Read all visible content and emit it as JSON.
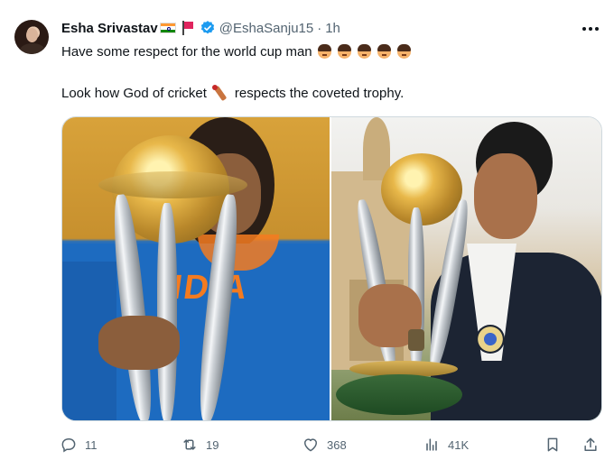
{
  "author": {
    "display_name": "Esha Srivastav",
    "handle": "@EshaSanju15",
    "time": "1h",
    "separator": "·"
  },
  "tweet": {
    "line1": "Have some respect for the world cup man",
    "line2_prefix": "Look how God of cricket",
    "line2_suffix": "respects the coveted trophy."
  },
  "media": {
    "left_photo": {
      "jersey_text": "NDIA"
    },
    "right_photo": {}
  },
  "actions": {
    "replies": "11",
    "reposts": "19",
    "likes": "368",
    "views": "41K"
  },
  "icons": {
    "more": "more-horizontal-icon",
    "verified": "verified-badge-icon",
    "reply": "reply-icon",
    "repost": "repost-icon",
    "like": "heart-icon",
    "views": "views-chart-icon",
    "bookmark": "bookmark-icon",
    "share": "share-icon"
  },
  "colors": {
    "text_primary": "#0f1419",
    "text_secondary": "#536471",
    "verified_blue": "#1d9bf0",
    "border": "#cfd9de"
  }
}
